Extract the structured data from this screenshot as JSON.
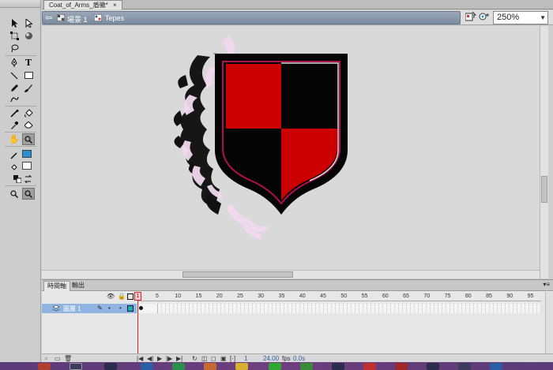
{
  "document_tab": {
    "title": "Coat_of_Arms_盾徽*",
    "close": "×"
  },
  "editbar": {
    "scene_label": "場景 1",
    "symbol_label": "Tepes",
    "zoom_value": "250%"
  },
  "timeline": {
    "tabs": [
      "時間軸",
      "輸出"
    ],
    "layer_name": "圖層 1",
    "ruler": [
      "1",
      "5",
      "10",
      "15",
      "20",
      "25",
      "30",
      "35",
      "40",
      "45",
      "50",
      "55",
      "60",
      "65",
      "70",
      "75",
      "80",
      "85",
      "90",
      "95"
    ],
    "current_frame": "1",
    "fps": "24.00",
    "fps_unit": "fps",
    "time": "0.0s"
  },
  "colors": {
    "shield_red": "#cc0000",
    "shield_black": "#050505",
    "stroke_fill_color": "#2a8fd0",
    "layer_highlight": "#8fb4e2",
    "taskbar": "#5a3b78"
  },
  "icons": {
    "tools": [
      "selection-arrow",
      "subselection-arrow",
      "free-transform",
      "gradient-transform",
      "lasso",
      "pen",
      "text",
      "line",
      "rectangle",
      "pencil",
      "brush",
      "deco",
      "bone",
      "paint-bucket",
      "ink-bottle",
      "eyedropper",
      "eraser",
      "hand",
      "zoom"
    ]
  }
}
